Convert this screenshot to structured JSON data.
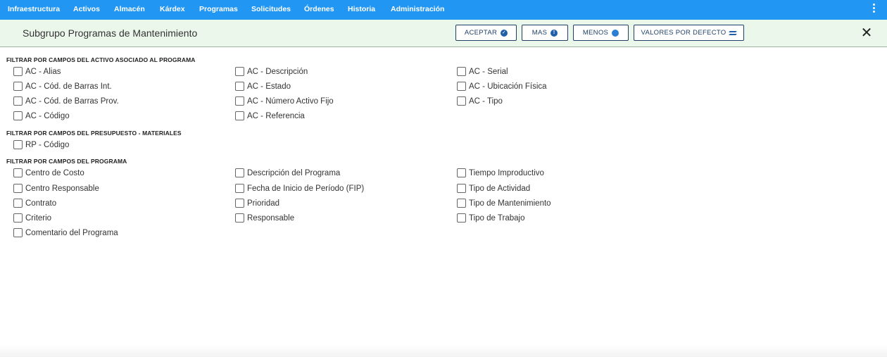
{
  "nav": {
    "items": [
      "Infraestructura",
      "Activos",
      "Almacén",
      "Kárdex",
      "Programas",
      "Solicitudes",
      "Órdenes",
      "Historia",
      "Administración"
    ]
  },
  "header": {
    "title": "Subgrupo Programas de Mantenimiento",
    "buttons": {
      "accept": "ACEPTAR",
      "more": "MAS",
      "less": "MENOS",
      "defaults": "VALORES POR DEFECTO"
    }
  },
  "sections": [
    {
      "title": "FILTRAR POR CAMPOS DEL ACTIVO ASOCIADO AL PROGRAMA",
      "columns": [
        [
          "AC - Alias",
          "AC - Cód. de Barras Int.",
          "AC - Cód. de Barras Prov.",
          "AC - Código"
        ],
        [
          "AC - Descripción",
          "AC - Estado",
          "AC - Número Activo Fijo",
          "AC - Referencia"
        ],
        [
          "AC - Serial",
          "AC - Ubicación Física",
          "AC - Tipo"
        ]
      ]
    },
    {
      "title": "FILTRAR POR CAMPOS DEL PRESUPUESTO - MATERIALES",
      "columns": [
        [
          "RP - Código"
        ]
      ]
    },
    {
      "title": "FILTRAR POR CAMPOS DEL PROGRAMA",
      "columns": [
        [
          "Centro de Costo",
          "Centro Responsable",
          "Contrato",
          "Criterio",
          "Comentario del Programa"
        ],
        [
          "Descripción del Programa",
          "Fecha de Inicio de Período (FIP)",
          "Prioridad",
          "Responsable"
        ],
        [
          "Tiempo Improductivo",
          "Tipo de Actividad",
          "Tipo de Mantenimiento",
          "Tipo de Trabajo"
        ]
      ]
    }
  ]
}
